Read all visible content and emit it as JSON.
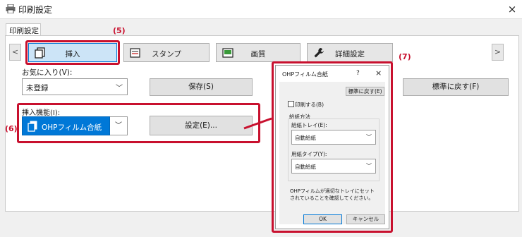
{
  "window": {
    "title": "印刷設定",
    "close_glyph": "×",
    "icon": "printer-icon"
  },
  "tab_label": "印刷設定",
  "scroll": {
    "left": "<",
    "right": ">"
  },
  "tabs": [
    {
      "label": "挿入",
      "icon": "insert-pages-icon",
      "active": true
    },
    {
      "label": "スタンプ",
      "icon": "stamp-icon",
      "active": false
    },
    {
      "label": "画質",
      "icon": "image-quality-icon",
      "active": false
    },
    {
      "label": "詳細設定",
      "icon": "wrench-icon",
      "active": false
    }
  ],
  "favorites": {
    "label": "お気に入り(V):",
    "value": "未登録",
    "save_button": "保存(S)",
    "reset_button": "標準に戻す(F)"
  },
  "insert": {
    "label": "挿入機能(I):",
    "value": "OHPフィルム合紙",
    "settings_button": "設定(E)..."
  },
  "callouts": {
    "c5": "(5)",
    "c6": "(6)",
    "c7": "(7)"
  },
  "popup": {
    "title": "OHPフィルム合紙",
    "help": "?",
    "close": "×",
    "reset_button": "標準に戻す(E)",
    "print_checkbox": "印刷する(B)",
    "print_checked": false,
    "feed_method": "給紙方法",
    "tray_label": "給紙トレイ(E):",
    "tray_value": "自動給紙",
    "paper_type_label": "用紙タイプ(Y):",
    "paper_type_value": "自動給紙",
    "note_line1": "OHPフィルムが適切なトレイにセット",
    "note_line2": "されていることを確認してください。",
    "ok": "OK",
    "cancel": "キャンセル"
  },
  "colors": {
    "accent": "#c8102e",
    "selection": "#0078d7"
  }
}
